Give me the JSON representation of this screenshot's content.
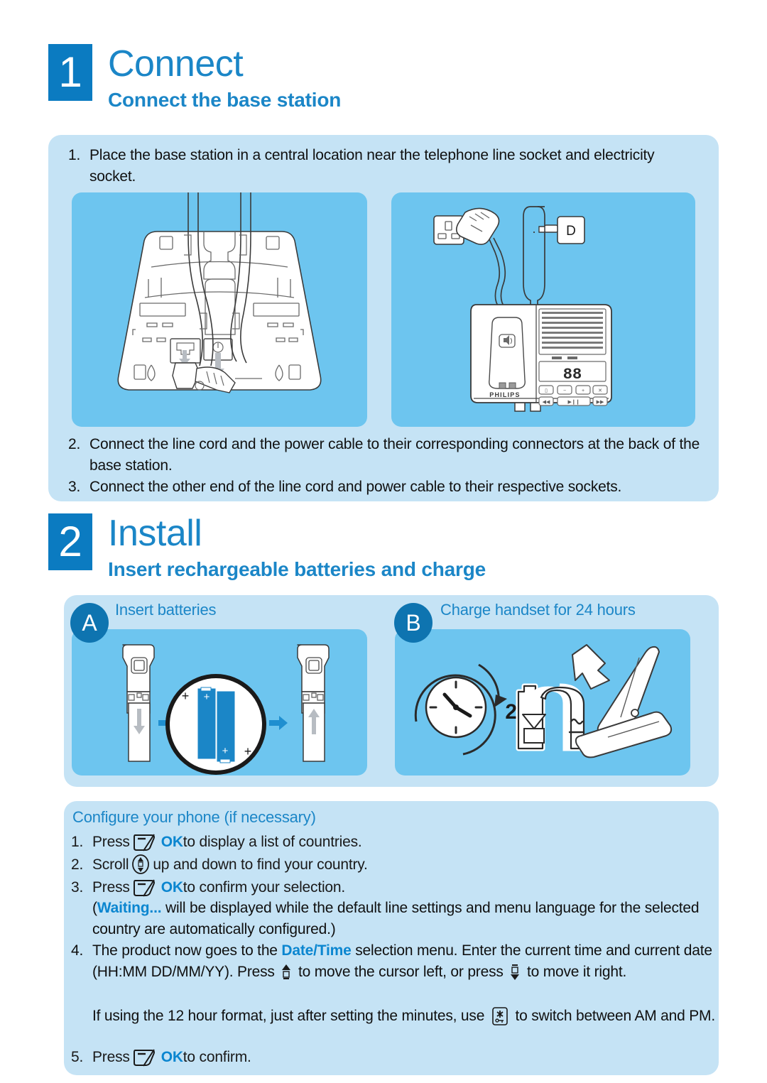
{
  "document": {
    "type": "quick-start-guide",
    "brand": "PHILIPS",
    "colors": {
      "accent_blue": "#0b7bc1",
      "heading_blue": "#1b86c7",
      "panel_blue": "#6dc5ef",
      "card_blue": "#c5e3f5",
      "badge_blue": "#0e74b0",
      "battery_blue": "#1b86c7"
    }
  },
  "section1": {
    "number": "1",
    "title": "Connect",
    "subtitle": "Connect the base station",
    "steps_top": [
      {
        "num": "1.",
        "text": "Place the base station in a central location near the telephone line socket and electricity socket."
      }
    ],
    "steps_bottom": [
      {
        "num": "2.",
        "text": "Connect the line cord and the power cable to their corresponding connectors at the back of the base station."
      },
      {
        "num": "3.",
        "text": "Connect the other end of the line cord and power cable to their respective sockets."
      }
    ],
    "figure_left": {
      "name": "base-station-underside-cabling",
      "description": "Underside of base station showing line cord and power cable routed into sockets"
    },
    "figure_right": {
      "name": "base-station-front-with-plug",
      "description": "Base station connected to mains plug and telephone wall socket",
      "wall_socket_label": "D",
      "base_brand": "PHILIPS",
      "base_display": "88"
    }
  },
  "section2": {
    "number": "2",
    "title": "Install",
    "subtitle": "Insert rechargeable batteries and charge",
    "sub_a": {
      "badge": "A",
      "label": "Insert batteries"
    },
    "sub_b": {
      "badge": "B",
      "label": "Charge handset for 24 hours"
    },
    "figure_a": {
      "name": "insert-batteries-diagram",
      "description": "Handset back cover removed, two AAA batteries inserted, cover replaced",
      "polarity_marks": [
        "+",
        "+",
        "+",
        "+"
      ]
    },
    "figure_b": {
      "name": "charge-handset-diagram",
      "description": "Clock showing 24 hours, battery charging from mains, handset placed in charger",
      "hours": "24"
    }
  },
  "configure": {
    "title": "Configure your phone (if necessary)",
    "steps": [
      {
        "num": "1.",
        "parts": [
          {
            "type": "text",
            "value": "Press "
          },
          {
            "type": "icon",
            "value": "softkey-ok-icon"
          },
          {
            "type": "bold",
            "value": "OK"
          },
          {
            "type": "text",
            "value": " to display a list of countries."
          }
        ]
      },
      {
        "num": "2.",
        "parts": [
          {
            "type": "text",
            "value": "Scroll "
          },
          {
            "type": "icon",
            "value": "scroll-key-icon"
          },
          {
            "type": "text",
            "value": " up and down to find your country."
          }
        ]
      },
      {
        "num": "3.",
        "parts": [
          {
            "type": "text",
            "value": "Press "
          },
          {
            "type": "icon",
            "value": "softkey-ok-icon"
          },
          {
            "type": "bold",
            "value": "OK"
          },
          {
            "type": "text",
            "value": " to confirm your selection."
          }
        ]
      }
    ],
    "note_open_paren": "(",
    "note_highlight": "Waiting...",
    "note_rest": " will be displayed while the default line settings and menu language for the selected country are automatically configured.)",
    "step4": {
      "num": "4.",
      "text_a": "The product now goes to the ",
      "highlight": "Date/Time",
      "text_b": " selection menu. Enter the current time and current date (HH:MM DD/MM/YY).  Press ",
      "icon_left": "up-key-icon",
      "text_c": " to move the cursor left, or press ",
      "icon_right": "down-key-icon",
      "text_d": " to move it right."
    },
    "step4_note": {
      "text_a": "If using the 12 hour format, just after setting the minutes, use ",
      "icon": "star-key-icon",
      "text_b": " to switch between AM and PM."
    },
    "step5": {
      "num": "5.",
      "text_a": "Press ",
      "icon": "softkey-ok-icon",
      "bold": "OK",
      "text_b": " to confirm."
    }
  }
}
